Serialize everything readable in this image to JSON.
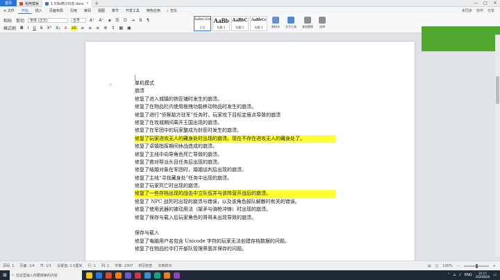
{
  "tabs": {
    "home": "首页",
    "items": [
      {
        "label": "稻壳模板",
        "icon_color": "#d94a2b"
      },
      {
        "label": "1.53b修订日志.docx",
        "icon_color": "#2a76d6"
      }
    ],
    "add": "+"
  },
  "window_controls": [
    "—",
    "□",
    "✕"
  ],
  "menu": {
    "file": "≡ 文件",
    "items": [
      "开始",
      "插入",
      "页面布局",
      "引用",
      "审阅",
      "视图",
      "章节",
      "开发工具",
      "特色应用"
    ],
    "active_index": 0,
    "search": "查找",
    "right": [
      "未同步",
      "协作",
      "分享"
    ]
  },
  "ribbon": {
    "paste": "粘贴",
    "cut": "剪切",
    "font_name": "宋体 (正文)",
    "font_size": "五号",
    "format_painter": "格式刷",
    "bold": "B",
    "italic": "I",
    "underline": "U",
    "styles": [
      {
        "sample": "AaBbCcDd",
        "label": "正文"
      },
      {
        "sample": "AaBb",
        "label": "标题 1"
      },
      {
        "sample": "AaBbC",
        "label": "标题 2"
      },
      {
        "sample": "AaBbCc",
        "label": "标题 3"
      }
    ],
    "tools": [
      {
        "label": "新样式",
        "color": "#6a8fd1"
      },
      {
        "label": "文字工具",
        "color": "#4f86d8"
      },
      {
        "label": "查找替换",
        "color": "#8a8f96"
      },
      {
        "label": "选择",
        "color": "#8a8f96"
      }
    ]
  },
  "document": {
    "lines": [
      {
        "text": "单机模式",
        "highlight": false
      },
      {
        "text": "崩溃",
        "highlight": false
      },
      {
        "text": "修复了进入城镇的铁匠铺时发生的崩溃。",
        "highlight": false
      },
      {
        "text": "修复了在物品栏内使用拖拽功能移动物品时发生的崩溃。",
        "highlight": false
      },
      {
        "text": "修复了进行“侦察敌方驻军”任务时，玩家攻下目标定居点导致的崩溃",
        "highlight": false
      },
      {
        "text": "修复了在攻城期间离开王国出现的崩溃。",
        "highlight": false
      },
      {
        "text": "修复了在军团中的玩家整成为封臣时发生的崩溃。",
        "highlight": false
      },
      {
        "text": "修复了玩家进攻无人的藏身处时出现的崩溃。现在不存在进攻无人的藏身处了。",
        "highlight": true
      },
      {
        "text": "修复了卓镇指挥期间休战造成的崩溃。",
        "highlight": false
      },
      {
        "text": "修复了主线中向导角色死亡导致的崩溃。",
        "highlight": false
      },
      {
        "text": "修复了救对帮派头目任务后出现的崩溃。",
        "highlight": false
      },
      {
        "text": "修复了结婚对象在军团时，婚姻谈判后出现的崩溃。",
        "highlight": false
      },
      {
        "text": "修复了主线“寻找藏身处”任务中出现的崩溃。",
        "highlight": false
      },
      {
        "text": "修复了玩家死亡时出现的崩溃。",
        "highlight": false
      },
      {
        "text": "修复了一些存档出现的战击中立队伍并与该阵营开战后的崩溃。",
        "highlight": true
      },
      {
        "text": "修复了 NPC 战死时出现的崩溃与错误，以及该角色部队解散时有关的错误。",
        "highlight": false
      },
      {
        "text": "修复了使用武器的被动用法（架矛与骑枪冲锋）时出现的崩溃。",
        "highlight": false
      },
      {
        "text": "修复了保存与载入后玩家角色的哥哥未出现导致的崩溃。",
        "highlight": false
      },
      {
        "text": "",
        "highlight": false
      },
      {
        "text": "保存与载入",
        "highlight": false
      },
      {
        "text": "修复了电脑用户名包含 Unicode 字符的玩家无法创建存档数据的问题。",
        "highlight": false
      },
      {
        "text": "修复了在物品栏中打开部队管理界面并保存的问题。",
        "highlight": false
      }
    ]
  },
  "status": {
    "left": [
      "页码: 1",
      "页面: 1/4",
      "节: 1/1",
      "设置值: 2.5厘米",
      "行: 1",
      "列: 1",
      "字数: 2307",
      "拼写检查",
      "文档校对"
    ],
    "zoom": "100%"
  },
  "taskbar": {
    "start": "⊞",
    "search": "在这里输入你要搜索的内容",
    "apps": [
      "#f0c419",
      "#2a76d6",
      "#d94a2b",
      "#f07f1a",
      "#6b5ac9",
      "#c9354f",
      "#3b8ed8",
      "#16a085",
      "#e67e22",
      "#8e44ad"
    ],
    "tray": [
      "ENG"
    ],
    "time": "21:17",
    "date": "2020/8/26"
  }
}
